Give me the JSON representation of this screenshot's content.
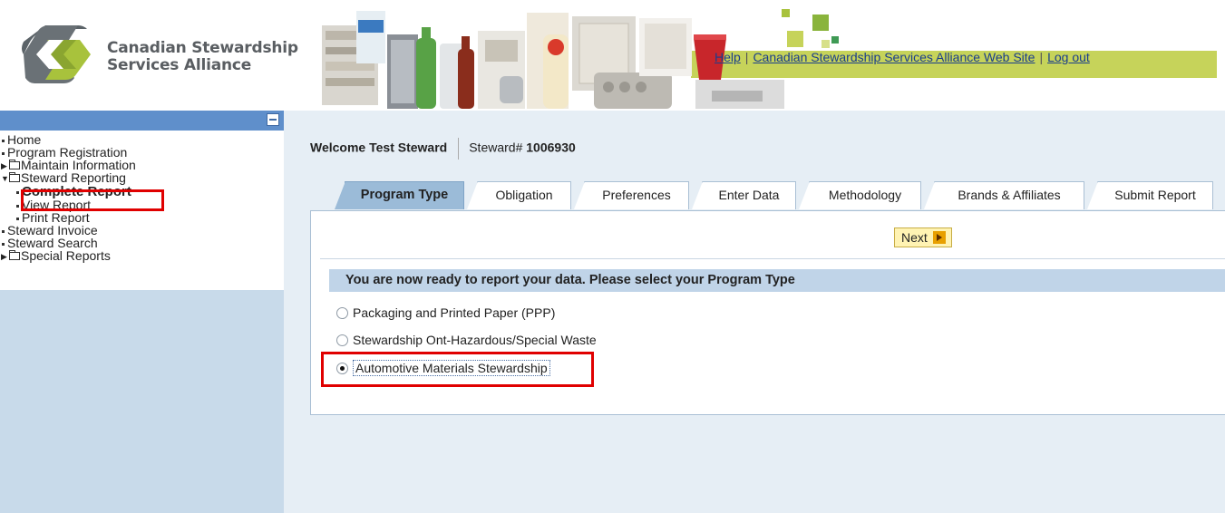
{
  "brand": {
    "name_line1": "Canadian Stewardship",
    "name_line2": "Services Alliance"
  },
  "top_links": {
    "help": "Help",
    "separator": "|",
    "website": "Canadian Stewardship Services Alliance Web Site",
    "logout": "Log out"
  },
  "sidebar": {
    "items": {
      "home": "Home",
      "program_registration": "Program Registration",
      "maintain_information": "Maintain Information",
      "steward_reporting": "Steward Reporting",
      "complete_report": "Complete Report",
      "view_report": "View Report",
      "print_report": "Print Report",
      "steward_invoice": "Steward Invoice",
      "steward_search": "Steward Search",
      "special_reports": "Special Reports"
    }
  },
  "welcome": {
    "prefix": "Welcome",
    "name": "Test Steward",
    "steward_label": "Steward#",
    "steward_number": "1006930"
  },
  "tabs": {
    "program_type": "Program Type",
    "obligation": "Obligation",
    "preferences": "Preferences",
    "enter_data": "Enter Data",
    "methodology": "Methodology",
    "brands_affiliates": "Brands & Affiliates",
    "submit_report": "Submit Report"
  },
  "next_label": "Next",
  "section_heading": "You are now ready to report your data. Please select your Program Type",
  "program_options": {
    "ppp": "Packaging and Printed Paper (PPP)",
    "hazardous": "Stewardship Ont-Hazardous/Special Waste",
    "automotive": "Automotive Materials Stewardship"
  },
  "selected_option": "automotive",
  "colors": {
    "sidebar_header": "#5f8fcb",
    "sidebar_bg": "#c8daea",
    "main_bg": "#e6eef5",
    "active_tab": "#9bbbd8",
    "accent_green": "#c6d35a",
    "annotation_red": "#e00000"
  }
}
